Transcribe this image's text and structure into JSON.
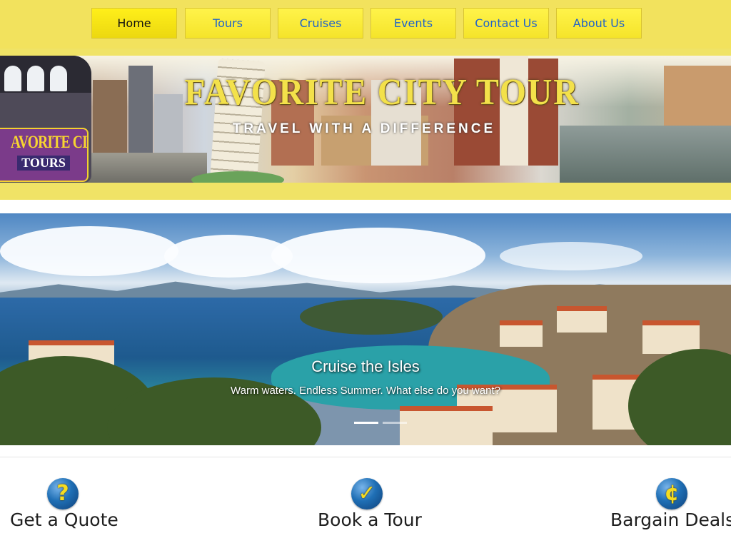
{
  "nav": {
    "items": [
      {
        "label": "Home",
        "active": true
      },
      {
        "label": "Tours",
        "active": false
      },
      {
        "label": "Cruises",
        "active": false
      },
      {
        "label": "Events",
        "active": false
      },
      {
        "label": "Contact Us",
        "active": false
      },
      {
        "label": "About Us",
        "active": false
      }
    ]
  },
  "banner": {
    "title": "FAVORITE CITY TOUR",
    "subtitle": "TRAVEL WITH A DIFFERENCE",
    "logo_line1": "AVORITE CITY",
    "logo_line2": "TOURS"
  },
  "hero": {
    "title": "Cruise the Isles",
    "subtitle": "Warm waters. Endless Summer. What else do you want?",
    "slide_count": 2,
    "active_slide": 1
  },
  "features": [
    {
      "icon": "question-icon",
      "glyph": "?",
      "label": "Get a Quote"
    },
    {
      "icon": "checkmark-icon",
      "glyph": "✓",
      "label": "Book a Tour"
    },
    {
      "icon": "cent-icon",
      "glyph": "¢",
      "label": "Bargain Deals"
    }
  ],
  "colors": {
    "nav_background": "#f2e25d",
    "nav_button": "#fff34a",
    "nav_link": "#1f63c9",
    "title_yellow": "#f3e14a",
    "icon_blue": "#1f6fb5"
  }
}
